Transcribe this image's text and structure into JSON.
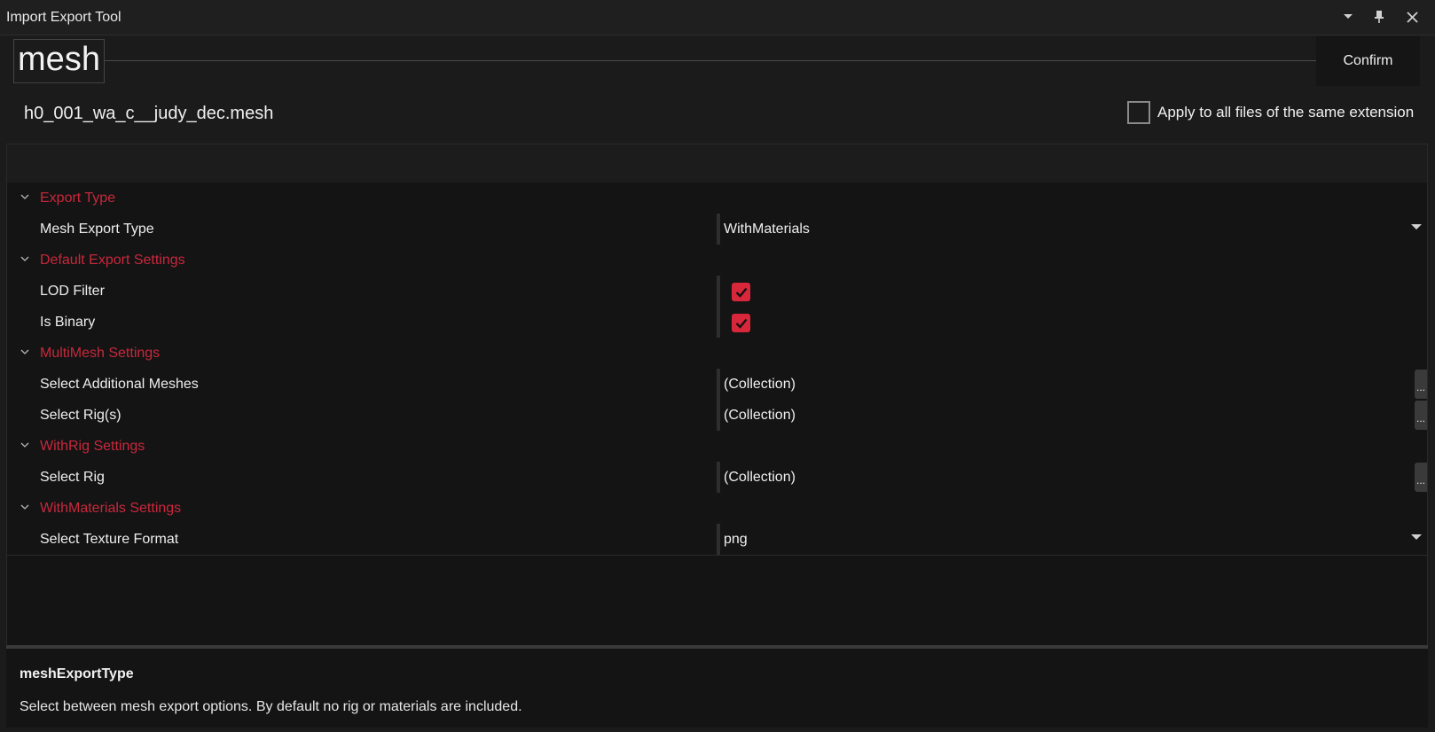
{
  "window": {
    "title": "Import Export Tool",
    "dropdown_icon": "chevron-down-icon",
    "pin_icon": "pin-icon",
    "close_icon": "close-icon"
  },
  "header": {
    "extension": "mesh",
    "confirm_label": "Confirm",
    "filename": "h0_001_wa_c__judy_dec.mesh",
    "apply_all_label": "Apply to all files of the same extension",
    "apply_all_checked": false
  },
  "grid": {
    "categories": [
      {
        "label": "Export Type"
      },
      {
        "label": "Default Export Settings"
      },
      {
        "label": "MultiMesh Settings"
      },
      {
        "label": "WithRig Settings"
      },
      {
        "label": "WithMaterials Settings"
      }
    ],
    "properties": [
      {
        "label": "Mesh Export Type",
        "value": "WithMaterials",
        "editor": "dropdown"
      },
      {
        "label": "LOD Filter",
        "value": true,
        "editor": "checkbox"
      },
      {
        "label": "Is Binary",
        "value": true,
        "editor": "checkbox"
      },
      {
        "label": "Select Additional Meshes",
        "value": "(Collection)",
        "editor": "collection",
        "button": "..."
      },
      {
        "label": "Select Rig(s)",
        "value": "(Collection)",
        "editor": "collection",
        "button": "..."
      },
      {
        "label": "Select Rig",
        "value": "(Collection)",
        "editor": "collection",
        "button": "..."
      },
      {
        "label": "Select Texture Format",
        "value": "png",
        "editor": "dropdown"
      }
    ]
  },
  "description": {
    "title": "meshExportType",
    "text": "Select between mesh export options. By default no rig or materials are included."
  },
  "colors": {
    "category_text": "#c8283c",
    "checkbox_fill": "#d8273a",
    "background": "#1b1b1b"
  }
}
